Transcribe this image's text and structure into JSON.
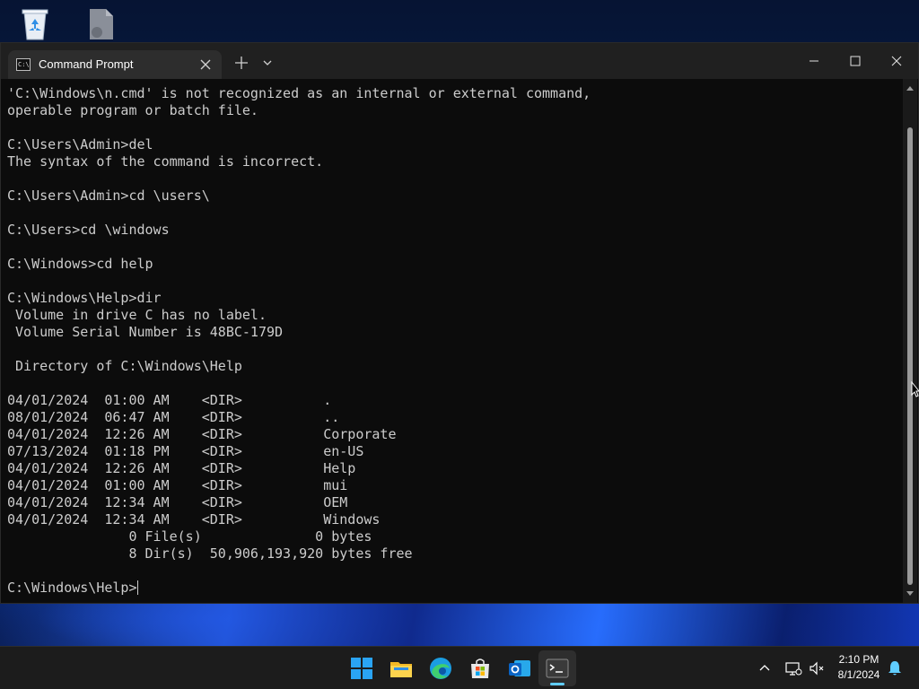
{
  "window": {
    "tab_title": "Command Prompt",
    "tab_icon": "cmd-icon",
    "close_tab_icon": "close-icon",
    "new_tab_icon": "plus-icon",
    "dropdown_icon": "chevron-down-icon",
    "controls": [
      "minimize-icon",
      "maximize-icon",
      "close-icon"
    ]
  },
  "console": {
    "lines": [
      "'C:\\Windows\\n.cmd' is not recognized as an internal or external command,",
      "operable program or batch file.",
      "",
      "C:\\Users\\Admin>del",
      "The syntax of the command is incorrect.",
      "",
      "C:\\Users\\Admin>cd \\users\\",
      "",
      "C:\\Users>cd \\windows",
      "",
      "C:\\Windows>cd help",
      "",
      "C:\\Windows\\Help>dir",
      " Volume in drive C has no label.",
      " Volume Serial Number is 48BC-179D",
      "",
      " Directory of C:\\Windows\\Help",
      "",
      "04/01/2024  01:00 AM    <DIR>          .",
      "08/01/2024  06:47 AM    <DIR>          ..",
      "04/01/2024  12:26 AM    <DIR>          Corporate",
      "07/13/2024  01:18 PM    <DIR>          en-US",
      "04/01/2024  12:26 AM    <DIR>          Help",
      "04/01/2024  01:00 AM    <DIR>          mui",
      "04/01/2024  12:34 AM    <DIR>          OEM",
      "04/01/2024  12:34 AM    <DIR>          Windows",
      "               0 File(s)              0 bytes",
      "               8 Dir(s)  50,906,193,920 bytes free",
      ""
    ],
    "prompt": "C:\\Windows\\Help>"
  },
  "desktop": {
    "icons": [
      "recycle-bin-icon",
      "document-icon"
    ]
  },
  "taskbar": {
    "apps": [
      "windows-start-icon",
      "file-explorer-icon",
      "edge-icon",
      "microsoft-store-icon",
      "outlook-icon",
      "terminal-icon"
    ],
    "active_app": "terminal-icon",
    "tray": [
      "chevron-up-icon",
      "network-icon",
      "volume-icon"
    ],
    "time": "2:10 PM",
    "date": "8/1/2024",
    "notification_icon": "bell-icon"
  },
  "colors": {
    "console_bg": "#0c0c0c",
    "console_text": "#cccccc",
    "titlebar": "#202020",
    "taskbar": "#1c1c1c",
    "accent": "#60cdff"
  }
}
